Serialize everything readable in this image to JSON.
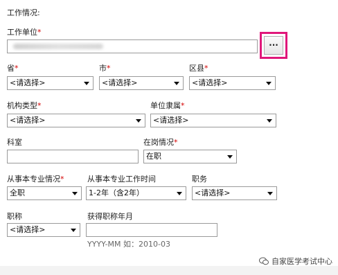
{
  "section_title": "工作情况:",
  "fields": {
    "work_unit": {
      "label": "工作单位",
      "button": "..."
    },
    "province": {
      "label": "省",
      "value": "<请选择>"
    },
    "city": {
      "label": "市",
      "value": "<请选择>"
    },
    "district": {
      "label": "区县",
      "value": "<请选择>"
    },
    "org_type": {
      "label": "机构类型",
      "value": "<请选择>"
    },
    "affiliation": {
      "label": "单位隶属",
      "value": "<请选择>"
    },
    "department": {
      "label": "科室",
      "value": ""
    },
    "employment_status": {
      "label": "在岗情况",
      "value": "在职"
    },
    "professional_status": {
      "label": "从事本专业情况",
      "value": "全职"
    },
    "professional_years": {
      "label": "从事本专业工作时间",
      "value": "1-2年（含2年）"
    },
    "position": {
      "label": "职务",
      "value": "<请选择>"
    },
    "title": {
      "label": "职称",
      "value": "<请选择>"
    },
    "title_date": {
      "label": "获得职称年月",
      "value": "",
      "hint": "YYYY-MM 如：2010-03"
    }
  },
  "required_mark": "*",
  "watermark": {
    "text": "自家医学考试中心",
    "icon": "wechat-icon"
  },
  "colors": {
    "highlight": "#e0177a",
    "required": "#d40000"
  }
}
